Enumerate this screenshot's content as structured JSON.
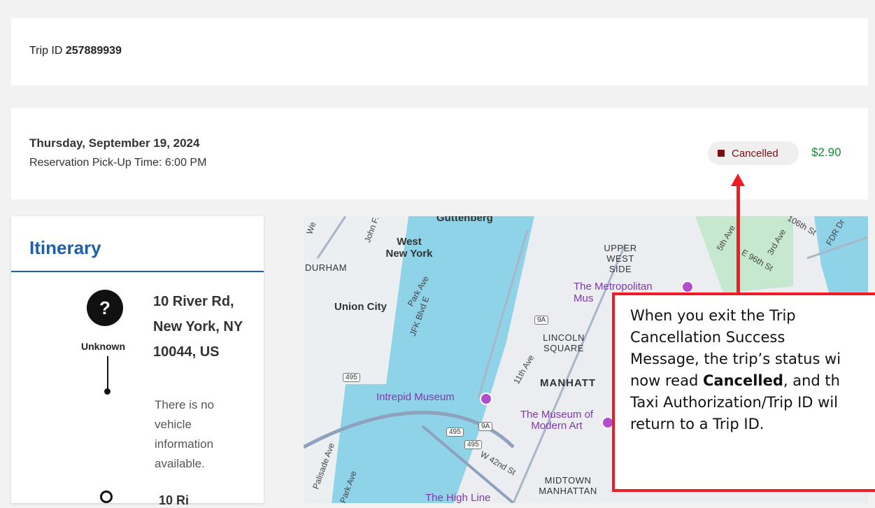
{
  "trip": {
    "label": "Trip ID",
    "id": "257889939"
  },
  "reservation": {
    "date": "Thursday, September 19, 2024",
    "pickup": "Reservation Pick-Up Time: 6:00 PM",
    "status": "Cancelled",
    "price": "$2.90",
    "status_color": "#7a0f12",
    "price_color": "#1a8a3c"
  },
  "itinerary": {
    "title": "Itinerary",
    "stop_icon": "?",
    "stop_status": "Unknown",
    "address": "10 River Rd, New York, NY 10044, US",
    "vehicle_info": "There is no vehicle information available.",
    "next_address": "10 Ri"
  },
  "map": {
    "labels": {
      "guttenberg": "Guttenberg",
      "west_new_york": "West New York",
      "durham": "DURHAM",
      "upper_west_side": "UPPER WEST SIDE",
      "union_city": "Union City",
      "lincoln_square": "LINCOLN SQUARE",
      "manhattan": "MANHATT",
      "midtown": "MIDTOWN MANHATTAN",
      "met": "The Metropolitan Mus",
      "intrepid": "Intrepid Museum",
      "moma": "The Museum of Modern Art",
      "high_line": "The High Line"
    },
    "streets": {
      "john_f": "John F.",
      "park_ave": "Park Ave",
      "jfk_blvd": "JFK Blvd E",
      "eleventh": "11th Ave",
      "w42": "W 42nd St",
      "fifth": "5th Ave",
      "third": "3rd Ave",
      "e96": "E 96th St",
      "e106": "106th St",
      "fdr": "FDR Dr",
      "palisade": "Palisade Ave",
      "park_ave2": "Park Ave",
      "we": "We"
    },
    "shields": {
      "r495a": "495",
      "r495b": "495",
      "r495c": "495",
      "r9a": "9A",
      "r9a2": "9A"
    },
    "water_color": "#8fd3e8"
  },
  "callout": {
    "line1": "When you exit the Trip",
    "line2": "Cancellation Success",
    "line3": "Message, the trip’s status wi",
    "line4_pre": "now read ",
    "line4_bold": "Cancelled",
    "line4_post": ", and th",
    "line5": "Taxi Authorization/Trip ID wil",
    "line6": "return to a Trip ID.",
    "border_color": "#ee1c24"
  }
}
